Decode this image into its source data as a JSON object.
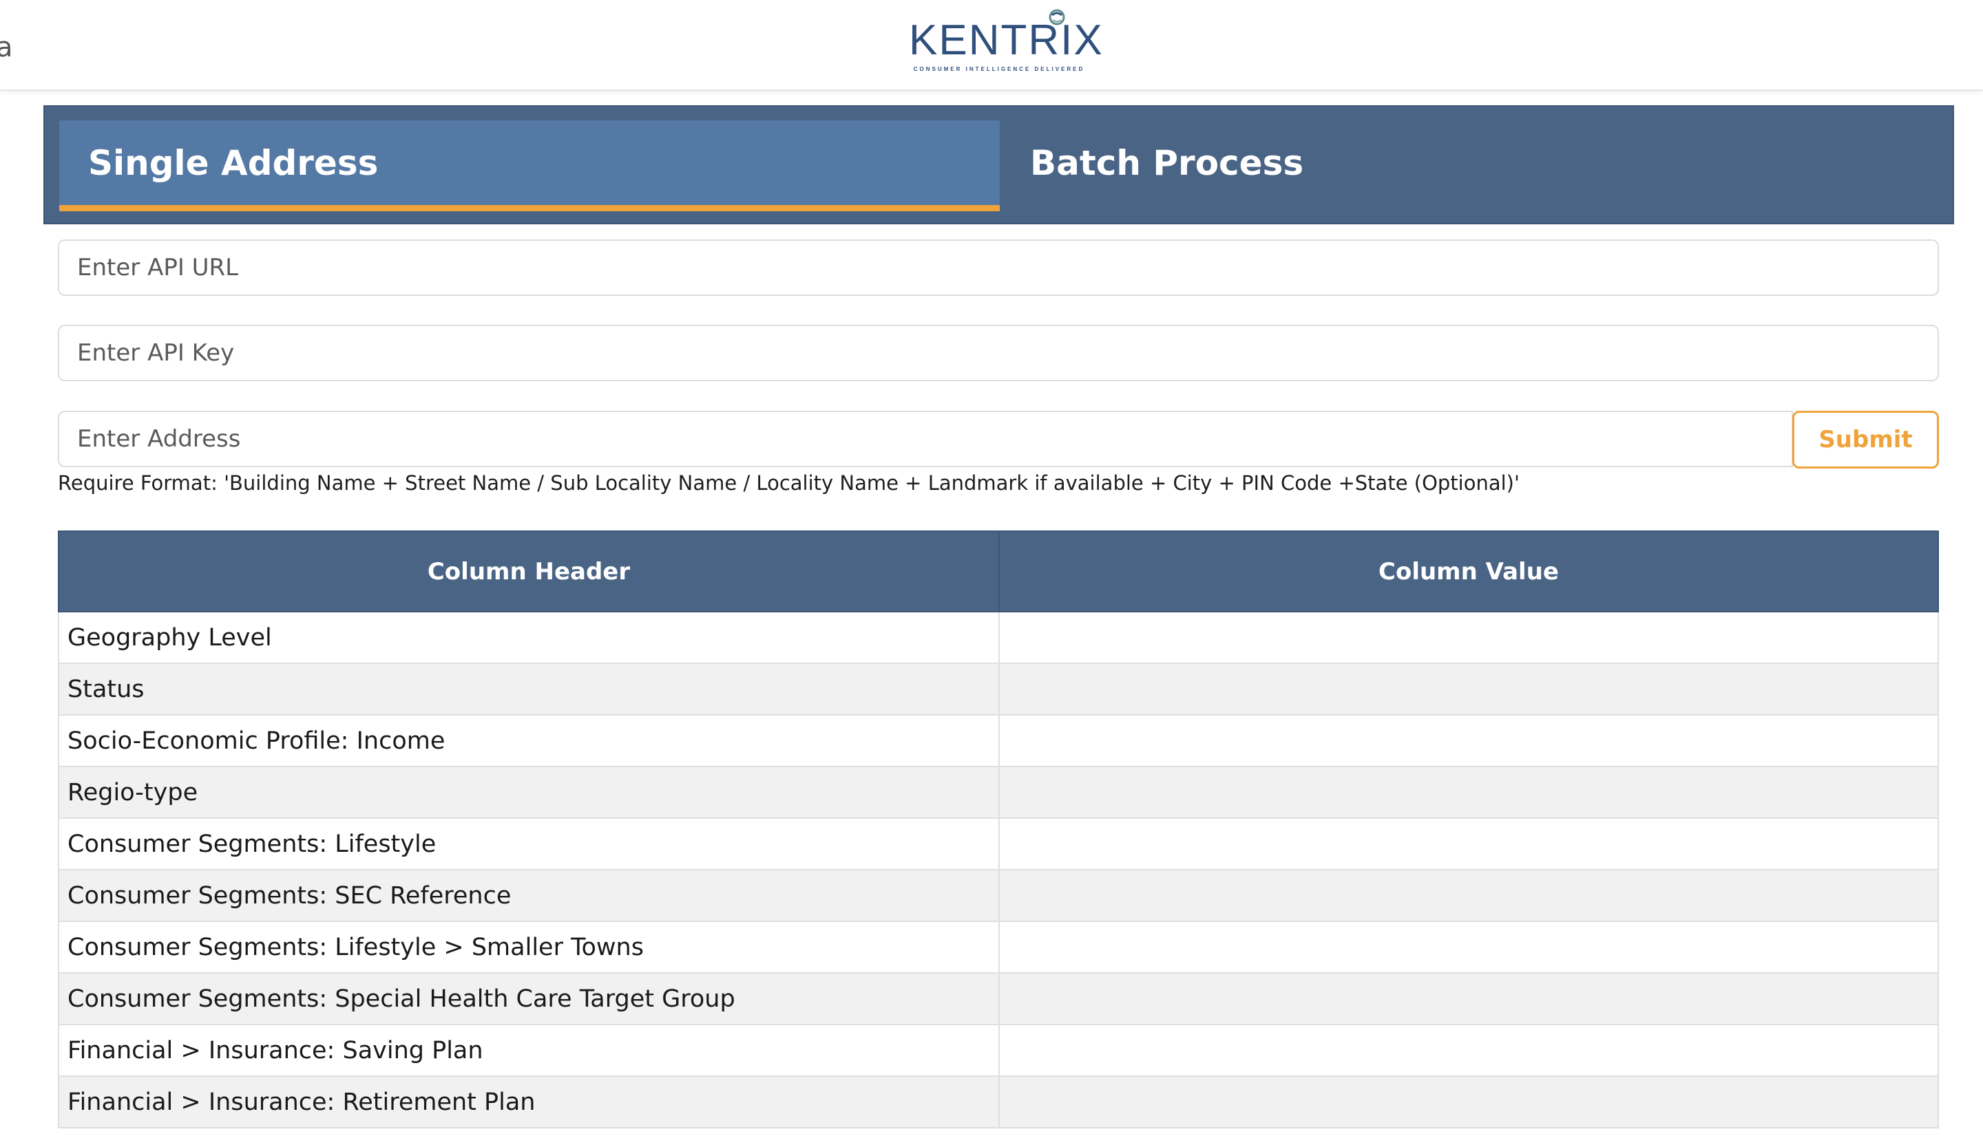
{
  "header": {
    "edge_mark": "a",
    "logo_text": "KENTRIX",
    "logo_tagline": "CONSUMER INTELLIGENCE DELIVERED"
  },
  "tabs": [
    {
      "label": "Single Address",
      "active": true
    },
    {
      "label": "Batch Process",
      "active": false
    }
  ],
  "form": {
    "api_url": {
      "placeholder": "Enter API URL",
      "value": ""
    },
    "api_key": {
      "placeholder": "Enter API Key",
      "value": ""
    },
    "address": {
      "placeholder": "Enter Address",
      "value": ""
    },
    "submit_label": "Submit",
    "format_note": "Require Format: 'Building Name + Street Name / Sub Locality Name / Locality Name + Landmark if available + City + PIN Code +State (Optional)'"
  },
  "table": {
    "columns": [
      "Column Header",
      "Column Value"
    ],
    "rows": [
      {
        "header": "Geography Level",
        "value": ""
      },
      {
        "header": "Status",
        "value": ""
      },
      {
        "header": "Socio-Economic Profile: Income",
        "value": ""
      },
      {
        "header": "Regio-type",
        "value": ""
      },
      {
        "header": "Consumer Segments: Lifestyle",
        "value": ""
      },
      {
        "header": "Consumer Segments: SEC Reference",
        "value": ""
      },
      {
        "header": "Consumer Segments: Lifestyle > Smaller Towns",
        "value": ""
      },
      {
        "header": "Consumer Segments: Special Health Care Target Group",
        "value": ""
      },
      {
        "header": "Financial > Insurance: Saving Plan",
        "value": ""
      },
      {
        "header": "Financial > Insurance: Retirement Plan",
        "value": ""
      }
    ]
  },
  "colors": {
    "brand_navy": "#2f4f7d",
    "tabbar_bg": "#4a6485",
    "active_tab_bg": "#5479a4",
    "accent_orange": "#efa33a",
    "row_alt_bg": "#f1f1f1"
  },
  "icons": {
    "logo_mark": "globe-swirl-icon"
  }
}
